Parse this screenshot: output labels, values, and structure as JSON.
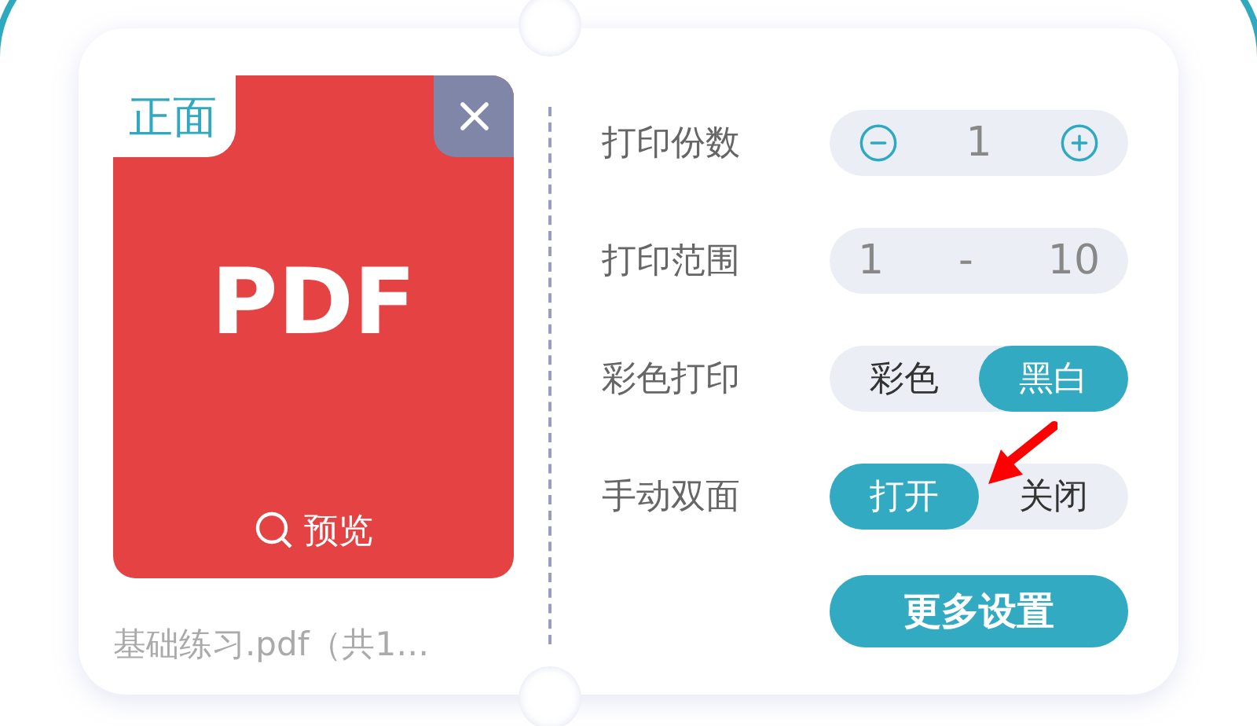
{
  "file": {
    "side_label": "正面",
    "type_label": "PDF",
    "preview_label": "预览",
    "name": "基础练习.pdf（共1…"
  },
  "settings": [
    {
      "kind": "stepper",
      "label": "打印份数",
      "value": "1"
    },
    {
      "kind": "range",
      "label": "打印范围",
      "from": "1",
      "separator": "-",
      "to": "10"
    },
    {
      "kind": "segmented",
      "label": "彩色打印",
      "options": [
        {
          "label": "彩色",
          "selected": false
        },
        {
          "label": "黑白",
          "selected": true
        }
      ]
    },
    {
      "kind": "segmented",
      "label": "手动双面",
      "options": [
        {
          "label": "打开",
          "selected": true
        },
        {
          "label": "关闭",
          "selected": false
        }
      ]
    }
  ],
  "more_button": "更多设置"
}
